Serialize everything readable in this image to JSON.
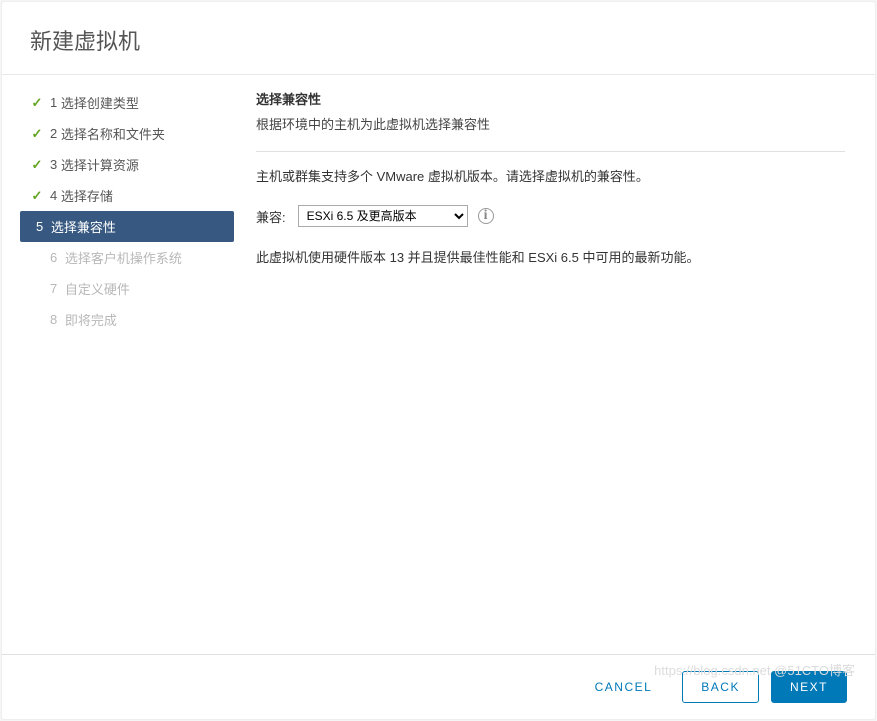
{
  "modal": {
    "title": "新建虚拟机"
  },
  "wizard": {
    "steps": [
      {
        "num": "1",
        "label": "选择创建类型",
        "status": "completed"
      },
      {
        "num": "2",
        "label": "选择名称和文件夹",
        "status": "completed"
      },
      {
        "num": "3",
        "label": "选择计算资源",
        "status": "completed"
      },
      {
        "num": "4",
        "label": "选择存储",
        "status": "completed"
      },
      {
        "num": "5",
        "label": "选择兼容性",
        "status": "active"
      },
      {
        "num": "6",
        "label": "选择客户机操作系统",
        "status": "pending"
      },
      {
        "num": "7",
        "label": "自定义硬件",
        "status": "pending"
      },
      {
        "num": "8",
        "label": "即将完成",
        "status": "pending"
      }
    ]
  },
  "panel": {
    "title": "选择兼容性",
    "description": "根据环境中的主机为此虚拟机选择兼容性",
    "info": "主机或群集支持多个 VMware 虚拟机版本。请选择虚拟机的兼容性。",
    "compat_label": "兼容:",
    "compat_value": "ESXi 6.5 及更高版本",
    "note": "此虚拟机使用硬件版本 13 并且提供最佳性能和 ESXi 6.5 中可用的最新功能。"
  },
  "footer": {
    "cancel": "CANCEL",
    "back": "BACK",
    "next": "NEXT"
  },
  "watermark": "https://blog.csdn.net @51CTO博客"
}
